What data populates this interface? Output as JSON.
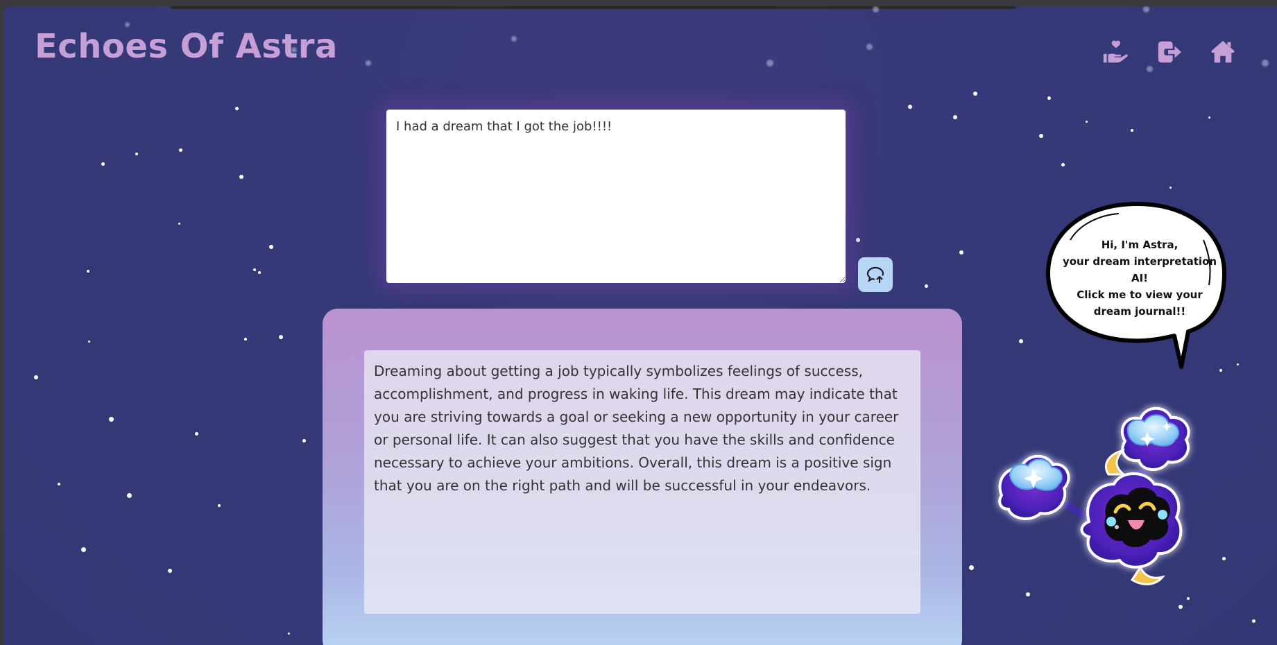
{
  "app": {
    "title": "Echoes Of Astra"
  },
  "nav": {
    "items": [
      {
        "name": "dream-journal",
        "icon": "hand-heart-icon"
      },
      {
        "name": "logout",
        "icon": "logout-icon"
      },
      {
        "name": "home",
        "icon": "home-icon"
      }
    ]
  },
  "dream_input": {
    "value": "I had a dream that I got the job!!!!",
    "placeholder": ""
  },
  "submit": {
    "icon": "chat-upload-icon"
  },
  "response": {
    "text": "Dreaming about getting a job typically symbolizes feelings of success, accomplishment, and progress in waking life. This dream may indicate that you are striving towards a goal or seeking a new opportunity in your career or personal life. It can also suggest that you have the skills and confidence necessary to achieve your ambitions. Overall, this dream is a positive sign that you are on the right path and will be successful in your endeavors."
  },
  "assistant": {
    "bubble_line1": "Hi, I'm Astra,",
    "bubble_line2": "your dream interpretation AI!",
    "bubble_line3": "Click me to view your",
    "bubble_line4": "dream journal!!",
    "mascot_icon": "cosmog-cloud-mascot"
  },
  "colors": {
    "background": "#353978",
    "accent": "#c59fd6",
    "submit_button": "#b7d6f6",
    "card_top": "#bb93cf",
    "card_bottom": "#b9d5f5"
  }
}
